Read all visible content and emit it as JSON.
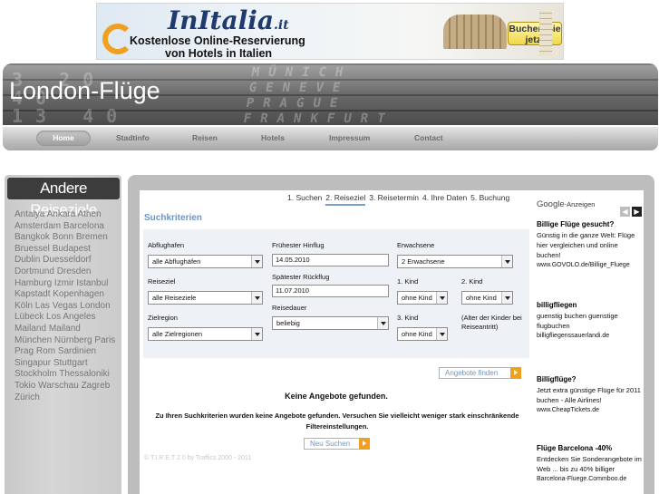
{
  "banner": {
    "logo": "InItalia",
    "logo_suffix": ".it",
    "line1": "Kostenlose Online-Reservierung",
    "line2": "von Hotels in Italien",
    "button": "Buchen Sie jetzt"
  },
  "header": {
    "title": "London-Flüge",
    "board_cities": "MÜNICH\nGENEVE\nPRAGUE\nFRANKFURT",
    "board_nums": "3 20\n40\n13 40"
  },
  "nav": {
    "items": [
      "Home",
      "Stadtinfo",
      "Reisen",
      "Hotels",
      "Impressum",
      "Contact"
    ]
  },
  "sidebar": {
    "title": "Andere Reiseziele",
    "links": [
      "Antalya",
      "Ankara",
      "Athen",
      "Amsterdam",
      "Barcelona",
      "Bangkok",
      "Bonn",
      "Bremen",
      "Bruessel",
      "Budapest",
      "Dublin",
      "Duesseldorf",
      "Dortmund",
      "Dresden",
      "Hamburg",
      "Izmir",
      "Istanbul",
      "Kapstadt",
      "Kopenhagen",
      "Köln",
      "Las Vegas",
      "London",
      "Lübeck",
      "Los Angeles",
      "Mailand",
      "Mailand",
      "München",
      "Nürnberg",
      "Paris",
      "Prag",
      "Rom",
      "Sardinien",
      "Singapur",
      "Stuttgart",
      "Stockholm",
      "Thessaloniki",
      "Tokio",
      "Warschau",
      "Zagreb",
      "Zürich"
    ]
  },
  "steps": [
    "1. Suchen",
    "2. Reiseziel",
    "3. Reisetermin",
    "4. Ihre Daten",
    "5. Buchung"
  ],
  "search": {
    "title": "Suchkriterien",
    "abflughafen_label": "Abflughafen",
    "abflughafen_value": "alle Abflughäfen",
    "reiseziel_label": "Reiseziel",
    "reiseziel_value": "alle Reiseziele",
    "zielregion_label": "Zielregion",
    "zielregion_value": "alle Zielregionen",
    "hinflug_label": "Frühester Hinflug",
    "hinflug_value": "14.05.2010",
    "rueckflug_label": "Spätester Rückflug",
    "rueckflug_value": "11.07.2010",
    "reisedauer_label": "Reisedauer",
    "reisedauer_value": "beliebig",
    "erwachsene_label": "Erwachsene",
    "erwachsene_value": "2 Erwachsene",
    "kind1_label": "1. Kind",
    "kind1_value": "ohne Kind",
    "kind2_label": "2. Kind",
    "kind2_value": "ohne Kind",
    "kind3_label": "3. Kind",
    "kind3_value": "ohne Kind",
    "kinder_hint": "(Alter der Kinder bei Reiseantritt)",
    "find_button": "Angebote finden"
  },
  "results": {
    "none": "Keine Angebote gefunden.",
    "hint": "Zu Ihren Suchkriterien wurden keine Angebote gefunden. Versuchen Sie vielleicht weniger stark einschränkende Filtereinstellungen.",
    "new_search": "Neu Suchen",
    "footer": "© T.I.R.E.T 2.0 by Traffics 2000 - 2011"
  },
  "ads": {
    "label_google": "Google",
    "label_ads": "-Anzeigen",
    "items": [
      {
        "title": "Billige Flüge gesucht?",
        "text": "Günstig in die ganze Welt: Flüge hier vergleichen und online buchen!",
        "url": "www.GOVOLO.de/Billige_Fluege"
      },
      {
        "title": "billigfliegen",
        "text": "guenstig buchen guenstige flugbuchen",
        "url": "billigfliegenssauerlandi.de"
      },
      {
        "title": "Billigflüge?",
        "text": "Jetzt extra günstige Flüge für 2011 buchen - Alle Airlines!",
        "url": "www.CheapTickets.de"
      },
      {
        "title": "Flüge Barcelona -40%",
        "text": "Entdecken Sie Sonderangebote im Web ... bis zu 40% billiger",
        "url": "Barcelona-Fluege.Commboo.de"
      }
    ]
  },
  "colors": {
    "accent": "#6f94c0",
    "orange": "#f0a020",
    "frame": "#bdbdbd"
  }
}
